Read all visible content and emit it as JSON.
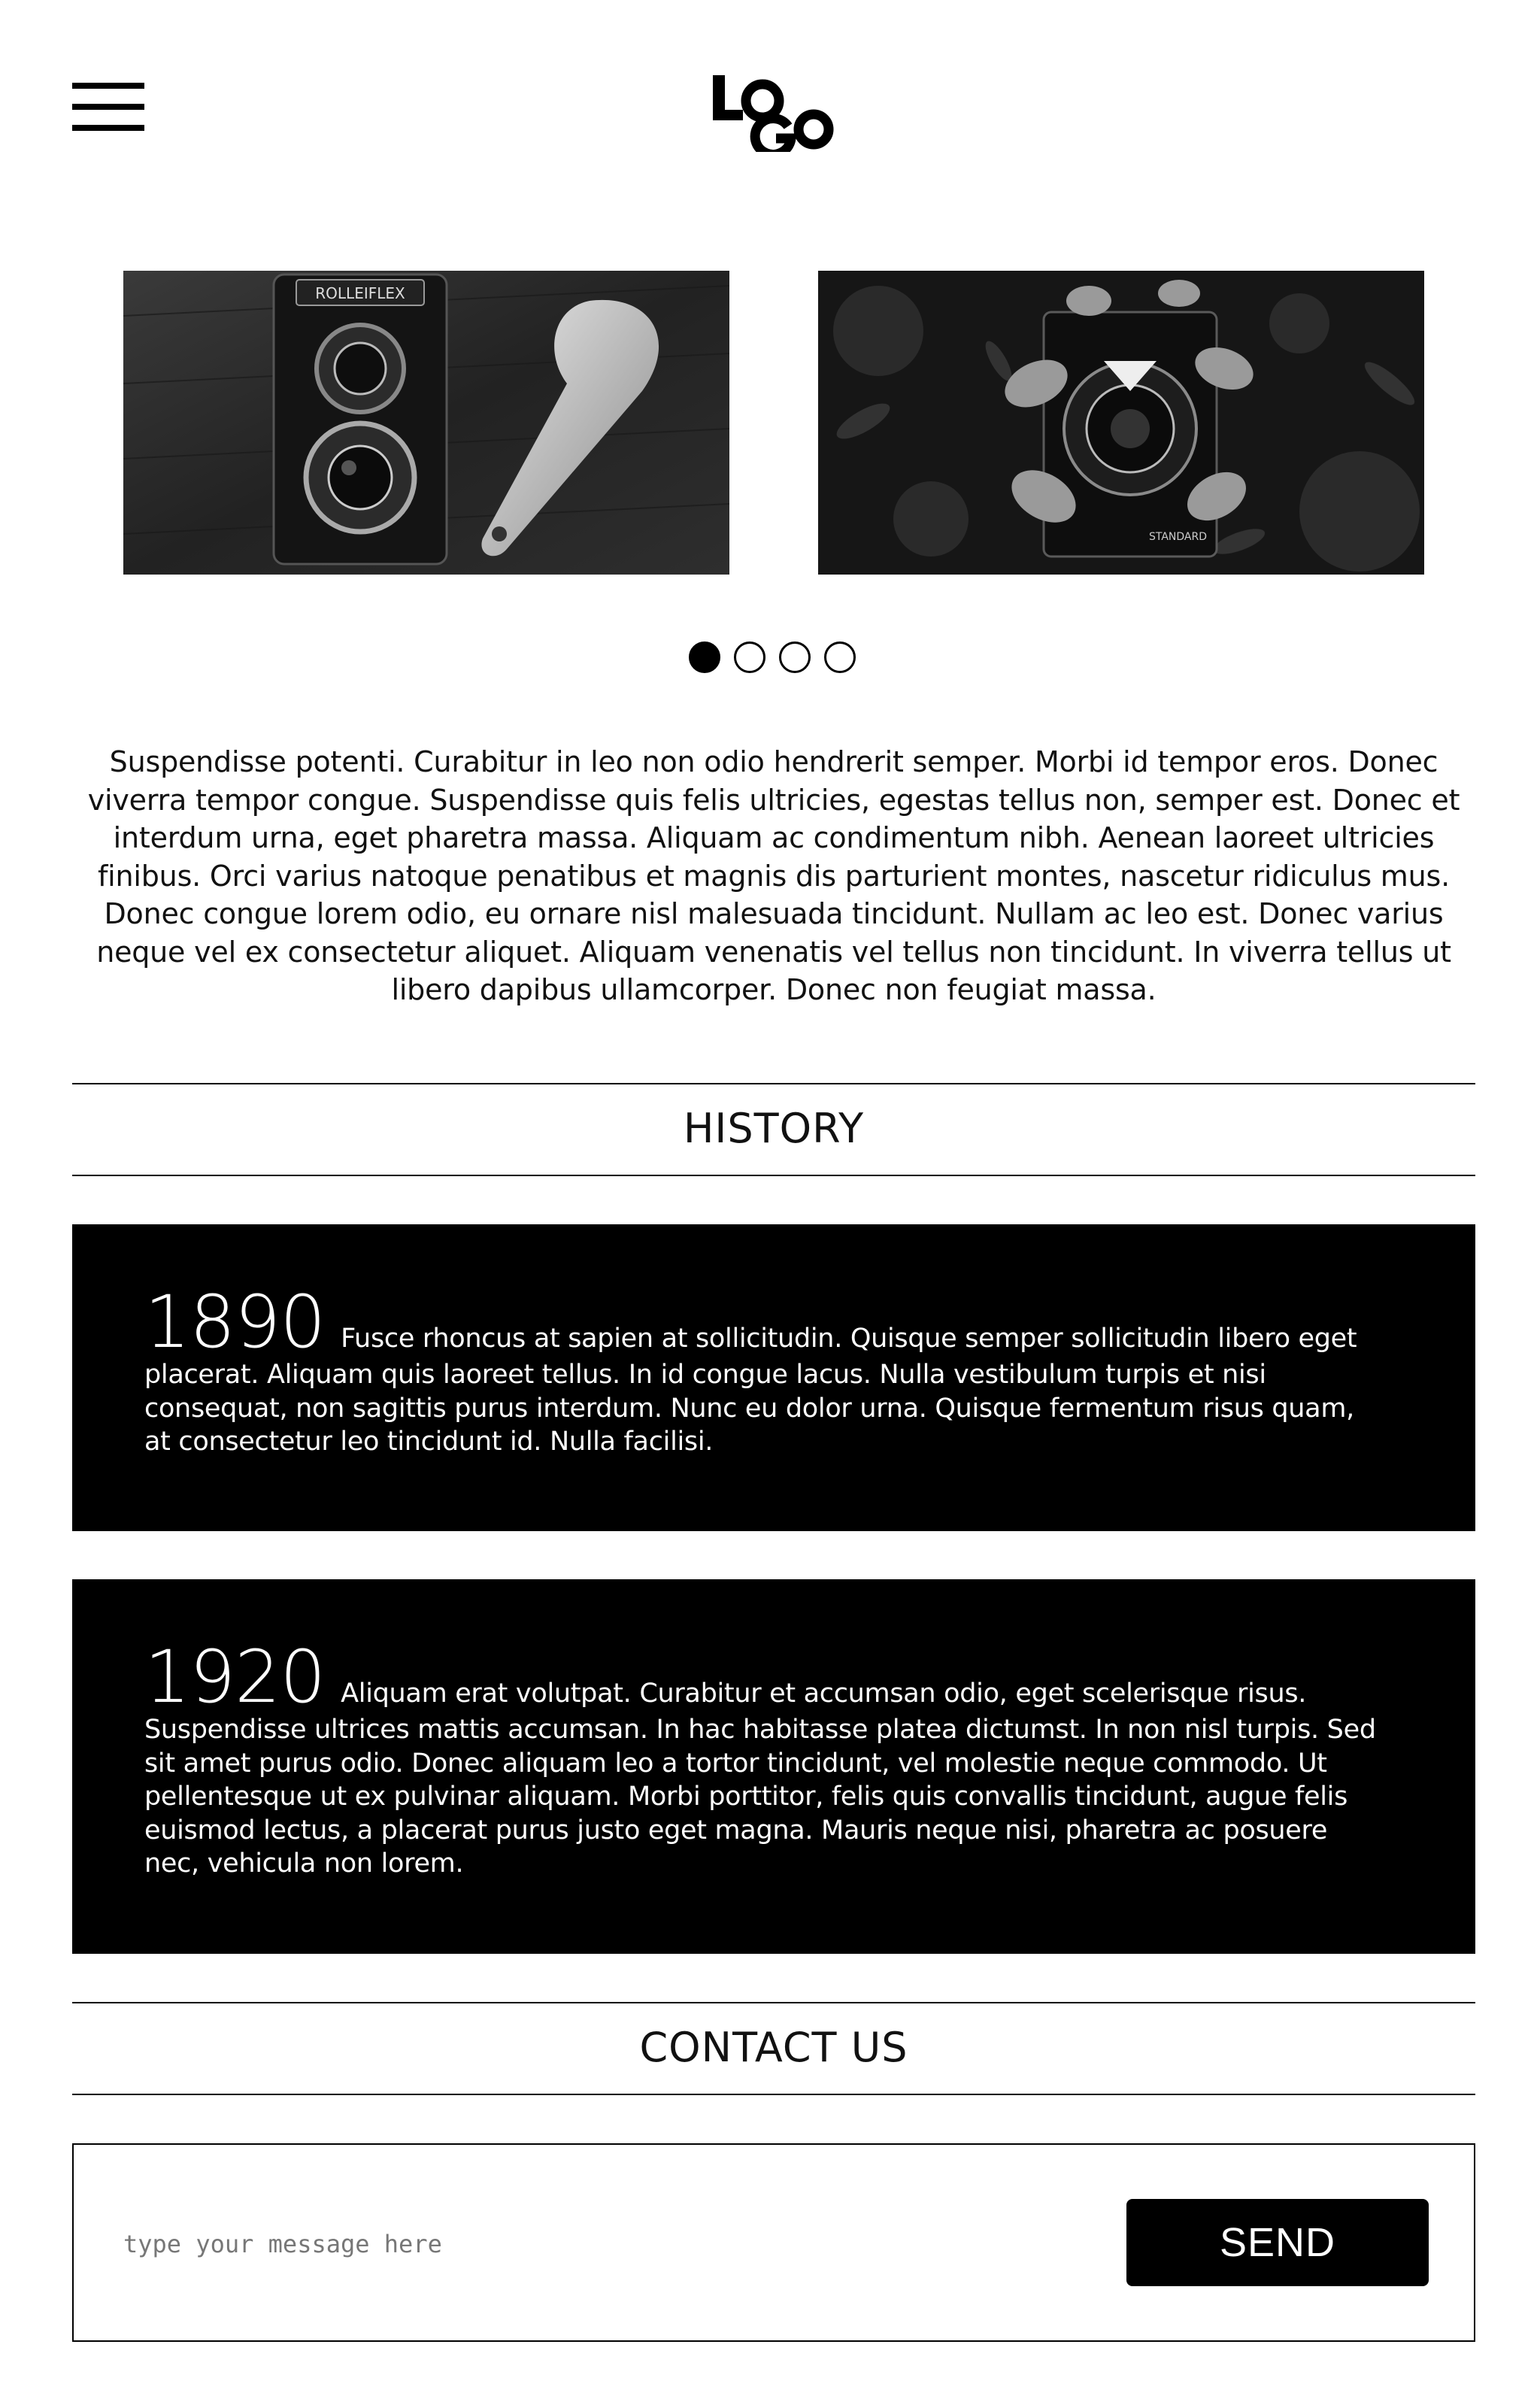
{
  "header": {
    "menu_icon": "hamburger-menu-icon",
    "logo_text": "LOGO"
  },
  "carousel": {
    "slides": [
      {
        "alt": "Rolleiflex camera and spoon",
        "brand_text": "ROLLEIFLEX"
      },
      {
        "alt": "Agfa camera among leaves",
        "brand_text": "STANDARD"
      }
    ],
    "active_dot": 0,
    "dot_count": 4
  },
  "intro": {
    "text": "Suspendisse potenti. Curabitur in leo non odio hendrerit semper. Morbi id tempor eros. Donec viverra tempor congue. Suspendisse quis felis ultricies, egestas tellus non, semper est. Donec et interdum urna, eget pharetra massa. Aliquam ac condimentum nibh. Aenean laoreet ultricies finibus. Orci varius natoque penatibus et magnis dis parturient montes, nascetur ridiculus mus. Donec congue lorem odio, eu ornare nisl malesuada tincidunt. Nullam ac leo est. Donec varius neque vel ex consectetur aliquet. Aliquam venenatis vel tellus non tincidunt. In viverra tellus ut libero dapibus ullamcorper. Donec non feugiat massa."
  },
  "history": {
    "title": "HISTORY",
    "entries": [
      {
        "year": "1890",
        "text": "Fusce rhoncus at sapien at sollicitudin. Quisque semper sollicitudin libero eget placerat. Aliquam quis laoreet tellus. In id congue lacus. Nulla vestibulum turpis et nisi consequat, non sagittis purus interdum. Nunc eu dolor urna. Quisque fermentum risus quam, at consectetur leo tincidunt id. Nulla facilisi."
      },
      {
        "year": "1920",
        "text": "Aliquam erat volutpat. Curabitur et accumsan odio, eget scelerisque risus. Suspendisse ultrices mattis accumsan. In hac habitasse platea dictumst. In non nisl turpis. Sed sit amet purus odio. Donec aliquam leo a tortor tincidunt, vel molestie neque commodo. Ut pellentesque ut ex pulvinar aliquam. Morbi porttitor, felis quis convallis tincidunt, augue felis euismod lectus, a placerat purus justo eget magna. Mauris neque nisi, pharetra ac posuere nec, vehicula non lorem."
      }
    ]
  },
  "contact": {
    "title": "CONTACT US",
    "placeholder": "type your message here",
    "send_label": "SEND"
  },
  "colors": {
    "background": "#ffffff",
    "ink": "#000000",
    "card_text": "#ffffff"
  }
}
